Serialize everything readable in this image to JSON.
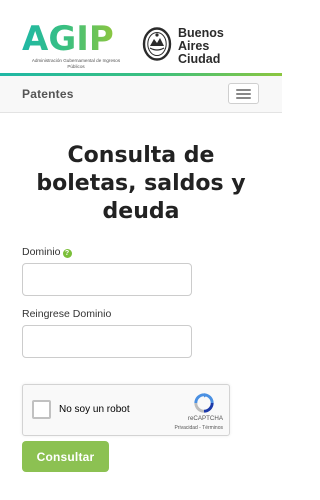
{
  "header": {
    "agip_logo_text": "AGIP",
    "agip_subtitle": "Administración Gubernamental de Ingresos Públicos",
    "city_logo_line1": "Buenos",
    "city_logo_line2": "Aires",
    "city_logo_line3": "Ciudad",
    "accent_colors": [
      "#1fb8a5",
      "#8cc63f"
    ]
  },
  "navbar": {
    "brand": "Patentes",
    "menu_icon": "hamburger-icon"
  },
  "main": {
    "title": "Consulta de boletas, saldos y deuda",
    "fields": [
      {
        "label": "Dominio",
        "help_icon": "question-circle-icon",
        "value": ""
      },
      {
        "label": "Reingrese Dominio",
        "value": ""
      }
    ],
    "recaptcha": {
      "label": "No soy un robot",
      "brand": "reCAPTCHA",
      "links": "Privacidad - Términos",
      "icon": "recaptcha-icon"
    },
    "submit_label": "Consultar",
    "submit_color": "#8cc152"
  }
}
